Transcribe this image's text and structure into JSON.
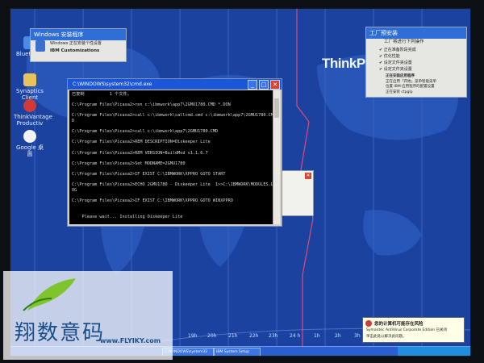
{
  "desktop": {
    "icons": [
      {
        "name": "bluetooth-icon",
        "label": "Bluetooth"
      },
      {
        "name": "folder-icon",
        "label": "Synaptics Client"
      },
      {
        "name": "thinkvantage-icon",
        "label": "ThinkVantage Productiv"
      },
      {
        "name": "google-icon",
        "label": "Google 桌面"
      }
    ],
    "brand_logo": "ThinkPad",
    "timezones": [
      "19h",
      "20h",
      "21h",
      "22h",
      "23h",
      "24 h",
      "1h",
      "2h",
      "3h"
    ]
  },
  "left_panel": {
    "title": "Windows 安装程序",
    "line1": "Windows 正在安装个性设置",
    "line2": "IBM Customizations"
  },
  "right_panel": {
    "title": "工厂预安装",
    "header": "工厂将进行下列操作",
    "steps": [
      "正在准备阶段完成",
      "优化性能",
      "设定文件夹设置",
      "设定文件夹设置"
    ],
    "status_lines": [
      "正在安装应用程序",
      "正在启用「开始」菜单智能菜单",
      "位置 IBM 应用程序的配置设置",
      "正在安装 ctpglp"
    ]
  },
  "cmd_window": {
    "title": "C:\\WINDOWS\\system32\\cmd.exe",
    "lines": [
      "已复制          1 个文件。",
      "",
      "C:\\Program Files\\Picasa2>ren c:\\ibmwork\\app7\\2GMU1780.CMD *.DON",
      "",
      "C:\\Program Files\\Picasa2>call c:\\ibmwork\\callcmd.cmd c:\\ibmwork\\app7\\2GMU1780.CM",
      "D",
      "",
      "C:\\Program Files\\Picasa2>call c:\\ibmwork\\app7\\2GMU1780.CMD",
      "",
      "C:\\Program Files\\Picasa2>REM DESCRIPTION=Diskeeper Lite",
      "",
      "C:\\Program Files\\Picasa2>REM VERSION=BuildMod v1.1.6.7",
      "",
      "C:\\Program Files\\Picasa2>Set MODNAME=2GMU1780",
      "",
      "C:\\Program Files\\Picasa2>IF EXIST C:\\IBMWORK\\XPPRO GOTO START",
      "",
      "C:\\Program Files\\Picasa2>ECHO 2GMU1780 - Diskeeper Lite  1>>C:\\IBMWORK\\MODULES.L",
      "OG",
      "",
      "C:\\Program Files\\Picasa2>IF EXIST C:\\IBMWORK\\XPPRO GOTO WINXPPRO",
      "",
      "",
      "    Please wait... Installing Diskeeper Lite"
    ]
  },
  "taskbar": {
    "buttons": [
      "C:\\WINDOWS\\system32",
      "IBM System Setup"
    ]
  },
  "balloon": {
    "title": "您的计算机可能存在风险",
    "body": "Symantec AntiVirus Corporate Edition 已关闭",
    "body2": "单击此处以解决此问题。"
  },
  "watermark": {
    "text": "翔数意码",
    "url": "www.FLYIKY.com"
  }
}
